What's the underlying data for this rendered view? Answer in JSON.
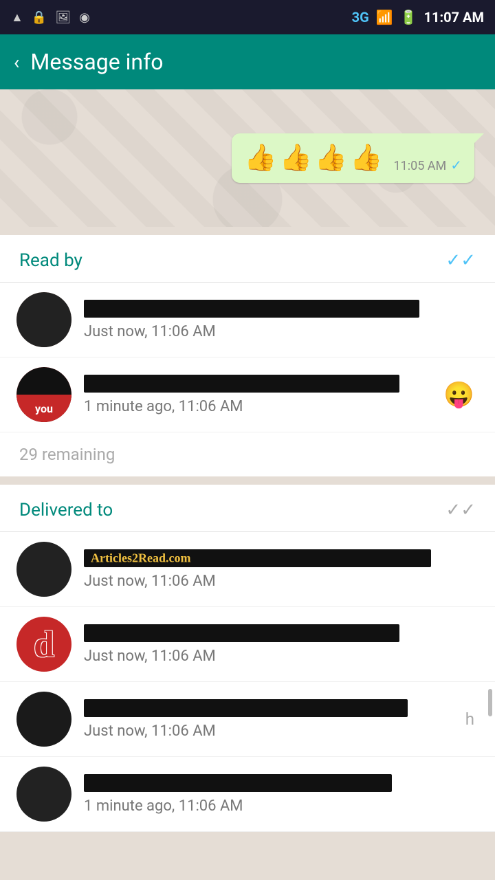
{
  "statusBar": {
    "time": "11:07 AM",
    "network": "3G",
    "icons": [
      "sim",
      "lock",
      "image",
      "circle"
    ]
  },
  "header": {
    "backLabel": "‹",
    "title": "Message info"
  },
  "messageBubble": {
    "emojis": "👍👍👍👍",
    "time": "11:05 AM",
    "checkmark": "✓"
  },
  "readSection": {
    "title": "Read by",
    "icon": "✓✓",
    "entries": [
      {
        "nameRedacted": true,
        "time": "Just now, 11:06 AM"
      },
      {
        "nameRedacted": true,
        "time": "1 minute ago, 11:06 AM",
        "reaction": "😛"
      }
    ],
    "remaining": "29 remaining"
  },
  "deliveredSection": {
    "title": "Delivered to",
    "icon": "✓✓",
    "entries": [
      {
        "watermark": "Articles2Read.com",
        "time": "Just now, 11:06 AM",
        "avatarType": "image-green"
      },
      {
        "nameRedacted": true,
        "time": "Just now, 11:06 AM",
        "avatarType": "letter-red",
        "letter": "d"
      },
      {
        "nameRedacted": true,
        "time": "Just now, 11:06 AM",
        "avatarType": "image-dark",
        "sideLabel": "h"
      },
      {
        "nameRedacted": true,
        "time": "1 minute ago, 11:06 AM",
        "avatarType": "image-light"
      }
    ]
  }
}
